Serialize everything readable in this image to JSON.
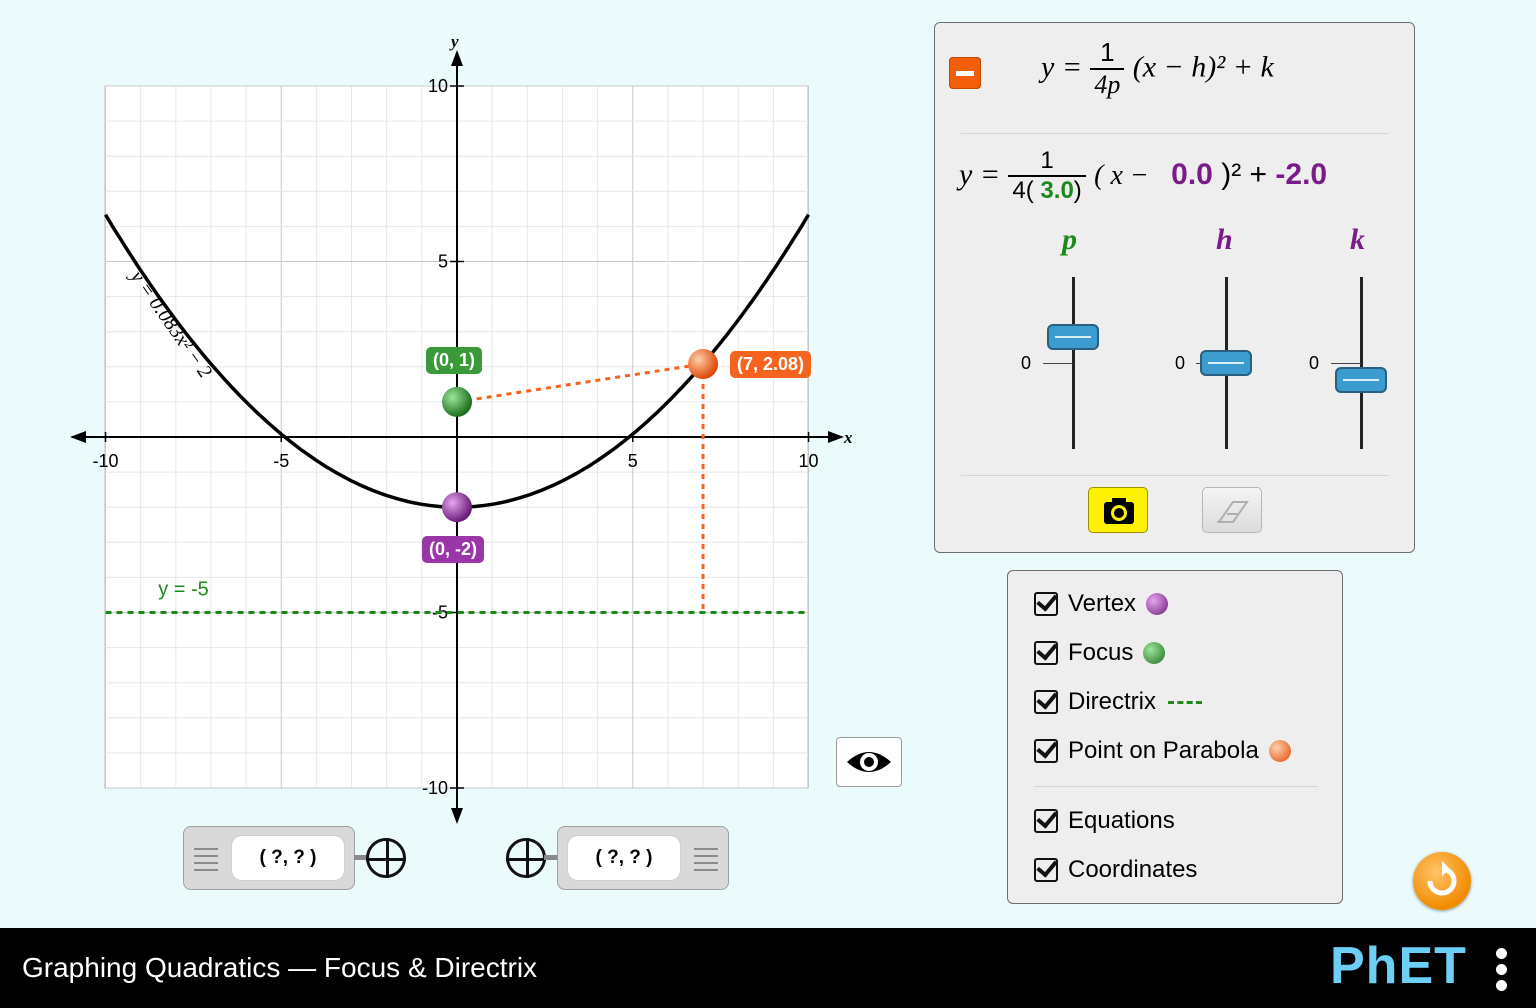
{
  "graph": {
    "x_axis_label": "x",
    "y_axis_label": "y",
    "x_range": [
      -10,
      10
    ],
    "y_range": [
      -10,
      10
    ],
    "x_ticks": [
      "-10",
      "-5",
      "5",
      "10"
    ],
    "y_ticks": [
      "10",
      "5",
      "-5",
      "-10"
    ],
    "parabola": {
      "p": 3.0,
      "h": 0.0,
      "k": -2.0,
      "equation_label": "y = 0.083x² − 2",
      "color": "#000000"
    },
    "vertex": {
      "x": 0,
      "y": -2,
      "label": "(0, -2)",
      "color": "#8e2b9c"
    },
    "focus": {
      "x": 0,
      "y": 1,
      "label": "(0, 1)",
      "color": "#2e8b2e"
    },
    "point_on_parabola": {
      "x": 7,
      "y": 2.08,
      "label": "(7, 2.08)",
      "color": "#f5641f"
    },
    "directrix": {
      "y": -5,
      "label": "y = -5",
      "color": "#1b8a1b"
    }
  },
  "equation_panel": {
    "general_form": {
      "lhs": "y =",
      "num": "1",
      "den": "4p",
      "rest": "(x − h)² + k"
    },
    "instance": {
      "lhs": "y =",
      "num": "1",
      "den_prefix": "4(",
      "p_value": "3.0",
      "den_suffix": ")",
      "open": "( x −",
      "h_value": "0.0",
      "close": ")² +",
      "k_value": "-2.0"
    },
    "sliders": [
      {
        "label": "p",
        "zero_label": "0",
        "value": 3.0,
        "min": -10,
        "max": 10,
        "color": "#1b8a1b"
      },
      {
        "label": "h",
        "zero_label": "0",
        "value": 0.0,
        "min": -10,
        "max": 10,
        "color": "#7a1b8a"
      },
      {
        "label": "k",
        "zero_label": "0",
        "value": -2.0,
        "min": -10,
        "max": 10,
        "color": "#7a1b8a"
      }
    ]
  },
  "checkboxes": [
    {
      "label": "Vertex",
      "checked": true
    },
    {
      "label": "Focus",
      "checked": true
    },
    {
      "label": "Directrix",
      "checked": true
    },
    {
      "label": "Point on Parabola",
      "checked": true
    },
    {
      "label": "Equations",
      "checked": true
    },
    {
      "label": "Coordinates",
      "checked": true
    }
  ],
  "probes": [
    {
      "readout": "( ?, ? )"
    },
    {
      "readout": "( ?, ? )"
    }
  ],
  "navbar": {
    "title": "Graphing Quadratics — Focus & Directrix",
    "logo": "PhET"
  }
}
